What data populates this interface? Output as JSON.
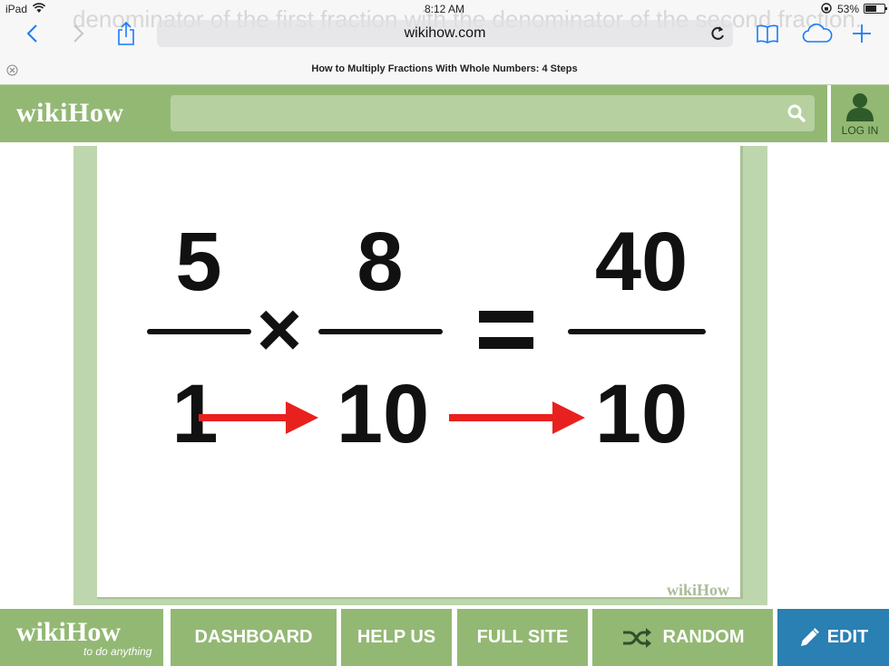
{
  "ghost_text": "denominator of the first fraction with the denominator of the second fraction.",
  "status_bar": {
    "carrier": "iPad",
    "time": "8:12 AM",
    "battery": "53%"
  },
  "browser": {
    "url": "wikihow.com",
    "tab_title": "How to Multiply Fractions With Whole Numbers: 4 Steps"
  },
  "header": {
    "logo_wiki": "wiki",
    "logo_how": "How",
    "search_placeholder": "",
    "login_label": "LOG IN"
  },
  "image": {
    "fraction1": {
      "numerator": "5",
      "denominator": "1"
    },
    "operator": "×",
    "fraction2": {
      "numerator": "8",
      "denominator": "10"
    },
    "equals": "=",
    "result": {
      "numerator": "40",
      "denominator": "10"
    },
    "arrow_color": "#e8211f",
    "watermark": "wikiHow"
  },
  "bottom_nav": {
    "logo_word": "wikiHow",
    "tagline": "to do anything",
    "dashboard": "DASHBOARD",
    "help_us": "HELP US",
    "full_site": "FULL SITE",
    "random": "RANDOM",
    "edit": "EDIT"
  },
  "colors": {
    "wikihow_green": "#93b874",
    "edit_blue": "#2a7fb3",
    "safari_blue": "#1a7cf5"
  }
}
